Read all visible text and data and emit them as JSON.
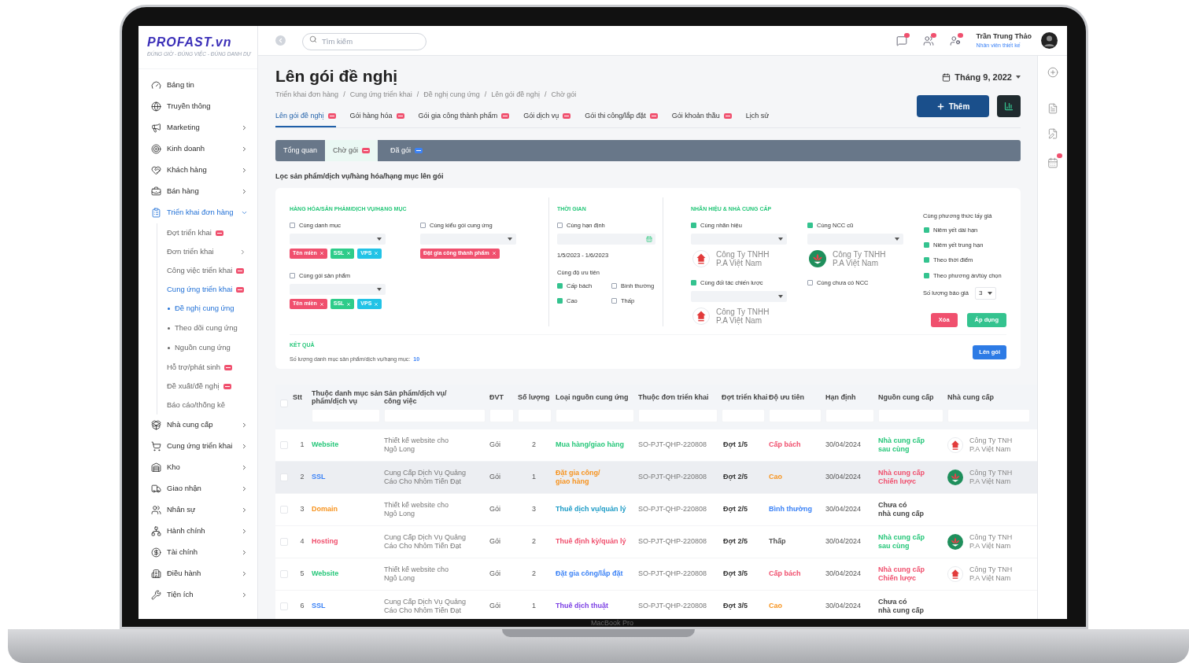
{
  "device": {
    "label": "MacBook Pro"
  },
  "logo": {
    "name": "PROFAST.vn",
    "tagline": "ĐÚNG GIỜ - ĐÚNG VIỆC - ĐÚNG DANH DỰ"
  },
  "sidebar": {
    "items": [
      {
        "label": "Bảng tin",
        "selected": false
      },
      {
        "label": "Truyền thông",
        "selected": false
      },
      {
        "label": "Marketing",
        "selected": false,
        "expanded": false
      },
      {
        "label": "Kinh doanh",
        "selected": false,
        "expanded": false
      },
      {
        "label": "Khách hàng",
        "selected": false,
        "expanded": false
      },
      {
        "label": "Bán hàng",
        "selected": false,
        "expanded": false
      },
      {
        "label": "Triển khai đơn hàng",
        "selected": true,
        "expanded": true,
        "children": [
          {
            "label": "Đợt triển khai",
            "selected": false,
            "badge": true
          },
          {
            "label": "Đơn triển khai",
            "selected": false,
            "badge": false,
            "expanded": false
          },
          {
            "label": "Công việc triển khai",
            "selected": false,
            "badge": true
          },
          {
            "label": "Cung ứng triển khai",
            "selected": true,
            "badge": true,
            "children": [
              {
                "label": "Đề nghị cung ứng",
                "selected": true
              },
              {
                "label": "Theo dõi cung ứng",
                "selected": false
              },
              {
                "label": "Nguồn cung ứng",
                "selected": false
              }
            ]
          },
          {
            "label": "Hỗ trợ/phát sinh",
            "selected": false,
            "badge": true
          },
          {
            "label": "Đề xuất/đề nghị",
            "selected": false,
            "badge": true
          },
          {
            "label": "Báo cáo/thống kê",
            "selected": false,
            "badge": false
          }
        ]
      },
      {
        "label": "Nhà cung cấp",
        "selected": false,
        "expanded": false
      },
      {
        "label": "Cung ứng triển khai",
        "selected": false,
        "expanded": false
      },
      {
        "label": "Kho",
        "selected": false,
        "expanded": false
      },
      {
        "label": "Giao nhận",
        "selected": false,
        "expanded": false
      },
      {
        "label": "Nhân sự",
        "selected": false,
        "expanded": false
      },
      {
        "label": "Hành chính",
        "selected": false,
        "expanded": false
      },
      {
        "label": "Tài chính",
        "selected": false,
        "expanded": false
      },
      {
        "label": "Điều hành",
        "selected": false,
        "expanded": false
      },
      {
        "label": "Tiện ích",
        "selected": false,
        "expanded": false
      }
    ]
  },
  "header": {
    "search_placeholder": "Tìm kiếm",
    "user": {
      "name": "Trần Trung Thảo",
      "role": "Nhân viên thiết kế"
    }
  },
  "page": {
    "title": "Lên gói đề nghị",
    "breadcrumb_separator": "/",
    "breadcrumbs": [
      "Triển khai đơn hàng",
      "Cung ứng triển khai",
      "Đề nghị cung ứng",
      "Lên gói đề nghị",
      "Chờ gói"
    ],
    "month": "Tháng 9, 2022",
    "add_button": "Thêm"
  },
  "tabs": [
    {
      "label": "Lên gói đề nghị",
      "badge": true,
      "selected": true
    },
    {
      "label": "Gói hàng hóa",
      "badge": true,
      "selected": false
    },
    {
      "label": "Gói gia công thành phẩm",
      "badge": true,
      "selected": false
    },
    {
      "label": "Gói dịch vụ",
      "badge": true,
      "selected": false
    },
    {
      "label": "Gói thi công/lắp đặt",
      "badge": true,
      "selected": false
    },
    {
      "label": "Gói khoản thầu",
      "badge": true,
      "selected": false
    },
    {
      "label": "Lịch sử",
      "badge": false,
      "selected": false
    }
  ],
  "subtabs": [
    {
      "label": "Tổng quan",
      "selected": false
    },
    {
      "label": "Chờ gói",
      "selected": true,
      "color": "#f0506e"
    },
    {
      "label": "Đã gói",
      "selected": false,
      "color": "#3b82f6"
    }
  ],
  "filter": {
    "title": "Lọc sản phẩm/dịch vụ/hàng hóa/hạng mục lên gói",
    "goods": {
      "title": "HÀNG HÓA/SẢN PHẨM/DỊCH VỤ/HẠNG MỤC",
      "groups": [
        {
          "label": "Cùng danh mục",
          "checked": false,
          "tags": [
            {
              "label": "Tên miền",
              "color": "#f0506e"
            },
            {
              "label": "SSL",
              "color": "#2ecc8a"
            },
            {
              "label": "VPS",
              "color": "#22c3e6"
            }
          ]
        },
        {
          "label": "Cùng kiểu gói cung ứng",
          "checked": false,
          "tags": [
            {
              "label": "Đặt gia công thành phẩm",
              "color": "#f0506e"
            }
          ]
        },
        {
          "label": "Cùng gói sản phẩm",
          "checked": false,
          "tags": [
            {
              "label": "Tên miền",
              "color": "#f0506e"
            },
            {
              "label": "SSL",
              "color": "#2ecc8a"
            },
            {
              "label": "VPS",
              "color": "#22c3e6"
            }
          ]
        }
      ]
    },
    "time": {
      "title": "THỜI GIAN",
      "deadline": {
        "label": "Cùng hạn định",
        "checked": false
      },
      "date_range": "1/5/2023 - 1/6/2023",
      "priority_title": "Cùng độ ưu tiên",
      "priorities": [
        {
          "label": "Cấp bách",
          "checked": true
        },
        {
          "label": "Bình thường",
          "checked": false
        },
        {
          "label": "Cao",
          "checked": true
        },
        {
          "label": "Thấp",
          "checked": false
        }
      ]
    },
    "brand": {
      "title": "NHÃN HIỆU & NHÀ CUNG CẤP",
      "groups": [
        {
          "label": "Cùng nhãn hiệu",
          "checked": true,
          "company": {
            "kind": "house",
            "name": [
              "Công Ty TNHH",
              "P.A Việt Nam"
            ]
          }
        },
        {
          "label": "Cùng NCC cũ",
          "checked": true,
          "company": {
            "kind": "flower",
            "name": [
              "Công Ty TNHH",
              "P.A Việt Nam"
            ]
          }
        },
        {
          "label": "Cùng đối tác chiến lược",
          "checked": true,
          "company": {
            "kind": "house",
            "name": [
              "Công Ty TNHH",
              "P.A Việt Nam"
            ]
          }
        },
        {
          "label": "Cùng chưa có NCC",
          "checked": false
        }
      ],
      "price_title": "Cùng phương thức lấy giá",
      "price_options": [
        {
          "label": "Niêm yết dài hạn",
          "checked": true
        },
        {
          "label": "Niêm yết trung hạn",
          "checked": true
        },
        {
          "label": "Theo thời điểm",
          "checked": true
        },
        {
          "label": "Theo phương án/tùy chọn",
          "checked": true
        }
      ],
      "quote_label": "Số lượng báo giá",
      "quote_value": "3"
    },
    "buttons": [
      {
        "label": "Xóa",
        "kind": "danger"
      },
      {
        "label": "Áp dụng",
        "kind": "success"
      }
    ],
    "result": {
      "title": "KẾT QUẢ",
      "label": "Số lượng danh mục sản phẩm/dịch vụ/hạng mục:",
      "count": "10",
      "button": "Lên gói"
    }
  },
  "table": {
    "header_checked": false,
    "columns": [
      "Stt",
      "Thuộc danh mục sản phẩm/dịch vụ",
      "Sản phẩm/dịch vụ/ công việc",
      "ĐVT",
      "Số lượng",
      "Loại nguồn cung ứng",
      "Thuộc đơn triển khai",
      "Đợt triển khai",
      "Độ ưu tiên",
      "Hạn định",
      "Nguồn cung cấp",
      "Nhà cung cấp"
    ],
    "rows": [
      {
        "selected": false,
        "checked": false,
        "stt": "1",
        "category": {
          "text": "Website",
          "color": "#27c77a"
        },
        "product": [
          "Thiết kế website cho",
          "Ngô Long"
        ],
        "unit": "Gói",
        "qty": "2",
        "source_type": {
          "text": [
            "Mua hàng/giao hàng"
          ],
          "color": "#27c77a"
        },
        "order": "SO-PJT-QHP-220808",
        "batch": "Đợt 1/5",
        "priority": {
          "text": "Cấp bách",
          "color": "#f0506e"
        },
        "deadline": "30/04/2024",
        "source": {
          "text": [
            "Nhà cung cấp",
            "sau cùng"
          ],
          "color": "#27c77a"
        },
        "supplier": {
          "kind": "house",
          "name": [
            "Công Ty TNH",
            "P.A Việt Nam"
          ]
        }
      },
      {
        "selected": true,
        "checked": false,
        "stt": "2",
        "category": {
          "text": "SSL",
          "color": "#3b82f6"
        },
        "product": [
          "Cung Cấp Dịch Vụ Quảng",
          "Cáo Cho Nhôm Tiến Đạt"
        ],
        "unit": "Gói",
        "qty": "1",
        "source_type": {
          "text": [
            "Đặt gia công/",
            "giao hàng"
          ],
          "color": "#f7931e"
        },
        "order": "SO-PJT-QHP-220808",
        "batch": "Đợt 2/5",
        "priority": {
          "text": "Cao",
          "color": "#f7931e"
        },
        "deadline": "30/04/2024",
        "source": {
          "text": [
            "Nhà cung cấp",
            "Chiến lược"
          ],
          "color": "#f0506e"
        },
        "supplier": {
          "kind": "flower",
          "name": [
            "Công Ty TNH",
            "P.A Việt Nam"
          ]
        }
      },
      {
        "selected": false,
        "checked": false,
        "stt": "3",
        "category": {
          "text": "Domain",
          "color": "#f7931e"
        },
        "product": [
          "Thiết kế website cho",
          "Ngô Long"
        ],
        "unit": "Gói",
        "qty": "3",
        "source_type": {
          "text": [
            "Thuê dịch vụ/quản lý"
          ],
          "color": "#1b9bc6"
        },
        "order": "SO-PJT-QHP-220808",
        "batch": "Đợt 2/5",
        "priority": {
          "text": "Bình thường",
          "color": "#3b82f6"
        },
        "deadline": "30/04/2024",
        "source": {
          "text": [
            "Chưa có",
            "nhà cung cấp"
          ],
          "color": "#444444"
        }
      },
      {
        "selected": false,
        "checked": false,
        "stt": "4",
        "category": {
          "text": "Hosting",
          "color": "#f0506e"
        },
        "product": [
          "Cung Cấp Dịch Vụ Quảng",
          "Cáo Cho Nhôm Tiến Đạt"
        ],
        "unit": "Gói",
        "qty": "2",
        "source_type": {
          "text": [
            "Thuê định kỳ/quản lý"
          ],
          "color": "#f0506e"
        },
        "order": "SO-PJT-QHP-220808",
        "batch": "Đợt 2/5",
        "priority": {
          "text": "Thấp",
          "color": "#555555"
        },
        "deadline": "30/04/2024",
        "source": {
          "text": [
            "Nhà cung cấp",
            "sau cùng"
          ],
          "color": "#27c77a"
        },
        "supplier": {
          "kind": "flower",
          "name": [
            "Công Ty TNH",
            "P.A Việt Nam"
          ]
        }
      },
      {
        "selected": false,
        "checked": false,
        "stt": "5",
        "category": {
          "text": "Website",
          "color": "#27c77a"
        },
        "product": [
          "Thiết kế website cho",
          "Ngô Long"
        ],
        "unit": "Gói",
        "qty": "2",
        "source_type": {
          "text": [
            "Đặt gia công/lắp đặt"
          ],
          "color": "#3b82f6"
        },
        "order": "SO-PJT-QHP-220808",
        "batch": "Đợt 3/5",
        "priority": {
          "text": "Cấp bách",
          "color": "#f0506e"
        },
        "deadline": "30/04/2024",
        "source": {
          "text": [
            "Nhà cung cấp",
            "Chiến lược"
          ],
          "color": "#f0506e"
        },
        "supplier": {
          "kind": "house",
          "name": [
            "Công Ty TNH",
            "P.A Việt Nam"
          ]
        }
      },
      {
        "selected": false,
        "checked": false,
        "stt": "6",
        "category": {
          "text": "SSL",
          "color": "#3b82f6"
        },
        "product": [
          "Cung Cấp Dịch Vụ Quảng",
          "Cáo Cho Nhôm Tiến Đạt"
        ],
        "unit": "Gói",
        "qty": "1",
        "source_type": {
          "text": [
            "Thuê dịch thuật"
          ],
          "color": "#7b3fe4"
        },
        "order": "SO-PJT-QHP-220808",
        "batch": "Đợt 3/5",
        "priority": {
          "text": "Cao",
          "color": "#f7931e"
        },
        "deadline": "30/04/2024",
        "source": {
          "text": [
            "Chưa có",
            "nhà cung cấp"
          ],
          "color": "#444444"
        }
      }
    ]
  }
}
